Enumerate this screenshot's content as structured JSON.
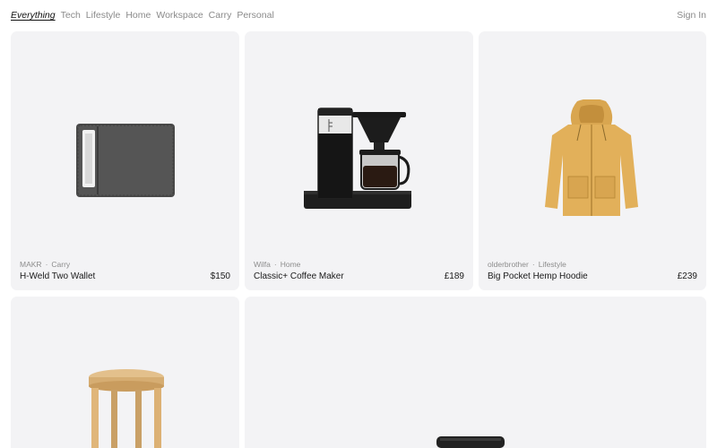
{
  "nav": {
    "items": [
      {
        "label": "Everything",
        "active": true
      },
      {
        "label": "Tech",
        "active": false
      },
      {
        "label": "Lifestyle",
        "active": false
      },
      {
        "label": "Home",
        "active": false
      },
      {
        "label": "Workspace",
        "active": false
      },
      {
        "label": "Carry",
        "active": false
      },
      {
        "label": "Personal",
        "active": false
      }
    ],
    "signin": "Sign In"
  },
  "products": [
    {
      "brand": "MAKR",
      "category": "Carry",
      "name": "H-Weld Two Wallet",
      "price": "$150",
      "icon": "wallet-image"
    },
    {
      "brand": "Wilfa",
      "category": "Home",
      "name": "Classic+ Coffee Maker",
      "price": "£189",
      "icon": "coffee-maker-image"
    },
    {
      "brand": "olderbrother",
      "category": "Lifestyle",
      "name": "Big Pocket Hemp Hoodie",
      "price": "£239",
      "icon": "hoodie-image"
    },
    {
      "icon": "stool-image"
    },
    {
      "icon": "product-image"
    }
  ],
  "colors": {
    "card_bg": "#f3f3f5",
    "nav_active": "#111111",
    "nav_muted": "#8a8a8a"
  }
}
